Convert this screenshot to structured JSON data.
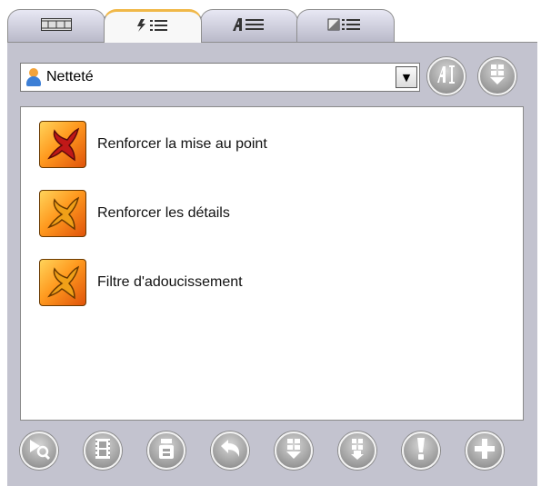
{
  "tabs": [
    {
      "icon": "filmstrip-icon",
      "glyph": "▭▭▭",
      "active": false
    },
    {
      "icon": "effects-list-icon",
      "glyph": "⚡☰",
      "active": true
    },
    {
      "icon": "text-list-icon",
      "glyph": "A☰",
      "active": false
    },
    {
      "icon": "transition-list-icon",
      "glyph": "◪☰",
      "active": false
    }
  ],
  "category": {
    "selected": "Netteté",
    "icon": "person-icon"
  },
  "effects": [
    {
      "label": "Renforcer la mise au point",
      "icon": "fx-effect-icon"
    },
    {
      "label": "Renforcer les détails",
      "icon": "fx-effect-icon"
    },
    {
      "label": "Filtre d'adoucissement",
      "icon": "fx-effect-icon"
    }
  ],
  "bottom_buttons": [
    {
      "name": "preview-button",
      "icon": "play-search-icon"
    },
    {
      "name": "video-button",
      "icon": "film-icon"
    },
    {
      "name": "layers-button",
      "icon": "layers-icon"
    },
    {
      "name": "undo-button",
      "icon": "undo-icon"
    },
    {
      "name": "import-button",
      "icon": "grid-down-icon"
    },
    {
      "name": "export-button",
      "icon": "grid-up-icon"
    },
    {
      "name": "info-button",
      "icon": "exclamation-icon"
    },
    {
      "name": "add-button",
      "icon": "plus-icon"
    }
  ]
}
